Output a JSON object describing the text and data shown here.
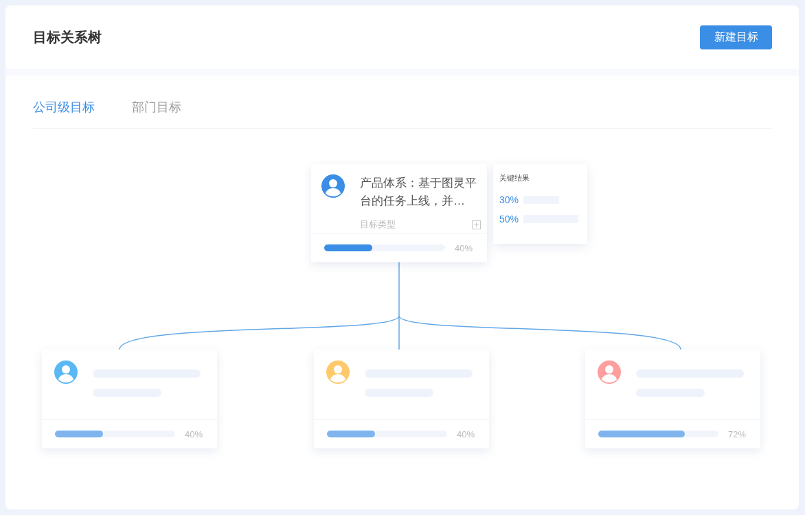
{
  "header": {
    "title": "目标关系树",
    "new_button": "新建目标"
  },
  "tabs": [
    {
      "label": "公司级目标",
      "selected": true
    },
    {
      "label": "部门目标",
      "selected": false
    }
  ],
  "tree": {
    "root": {
      "title": "产品体系：基于图灵平台的任务上线，并…",
      "type_label": "目标类型",
      "level": 0.4,
      "reading": "40%"
    },
    "key_results": {
      "heading": "关键结果",
      "items": [
        {
          "reading": "30%"
        },
        {
          "reading": "50%"
        }
      ]
    },
    "children": [
      {
        "color": "#5ab8f5",
        "level": 0.4,
        "reading": "40%"
      },
      {
        "color": "#ffc96b",
        "level": 0.4,
        "reading": "40%"
      },
      {
        "color": "#ff9e9e",
        "level": 0.72,
        "reading": "72%"
      }
    ]
  }
}
